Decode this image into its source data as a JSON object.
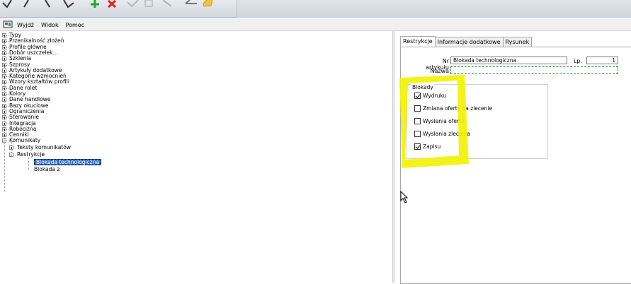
{
  "menu": {
    "items": [
      "Wyjdź",
      "Widok",
      "Pomoc"
    ]
  },
  "tree": {
    "top_items": [
      "Typy",
      "Przenikalność złożeń",
      "Profile główne",
      "Dobór uszczelek...",
      "Szklenia",
      "Szprosy",
      "Artykuły dodatkowe",
      "Kategorie wzmocnień",
      "Wzory kształtów profili",
      "Dane rolet",
      "Kolory",
      "Dane handlowe",
      "Bazy okuciowe",
      "Ograniczenia",
      "Sterowanie",
      "Integracja",
      "Robocizna",
      "Cenniki"
    ],
    "komunikaty": {
      "label": "Komunikaty",
      "children": {
        "teksty": "Teksty komunikatów",
        "restrykcje": "Restrykcje",
        "leaves": [
          "Blokada technologiczna",
          "Blokada z"
        ]
      }
    }
  },
  "tabs": [
    "Restrykcje",
    "Informacje dodatkowe",
    "Rysunek"
  ],
  "form": {
    "nr_artykulu_label": "Nr artykułu",
    "nr_artykulu_value": "Blokada technologiczna",
    "lp_label": "Lp.",
    "lp_value": "1",
    "nazwa_label": "Nazwa",
    "nazwa_value": ""
  },
  "blokady": {
    "title": "Blokady",
    "items": [
      {
        "label": "Wydruku",
        "checked": true
      },
      {
        "label": "Zmiana oferty na zlecenie",
        "checked": false
      },
      {
        "label": "Wysłania oferty",
        "checked": false
      },
      {
        "label": "Wysłania zlecenia",
        "checked": false
      },
      {
        "label": "Zapisu",
        "checked": true
      }
    ]
  },
  "colors": {
    "highlight": "#f2f200",
    "selection": "#2d6ec9",
    "toolbar_red": "#e02020",
    "toolbar_green": "#2aa22a"
  }
}
